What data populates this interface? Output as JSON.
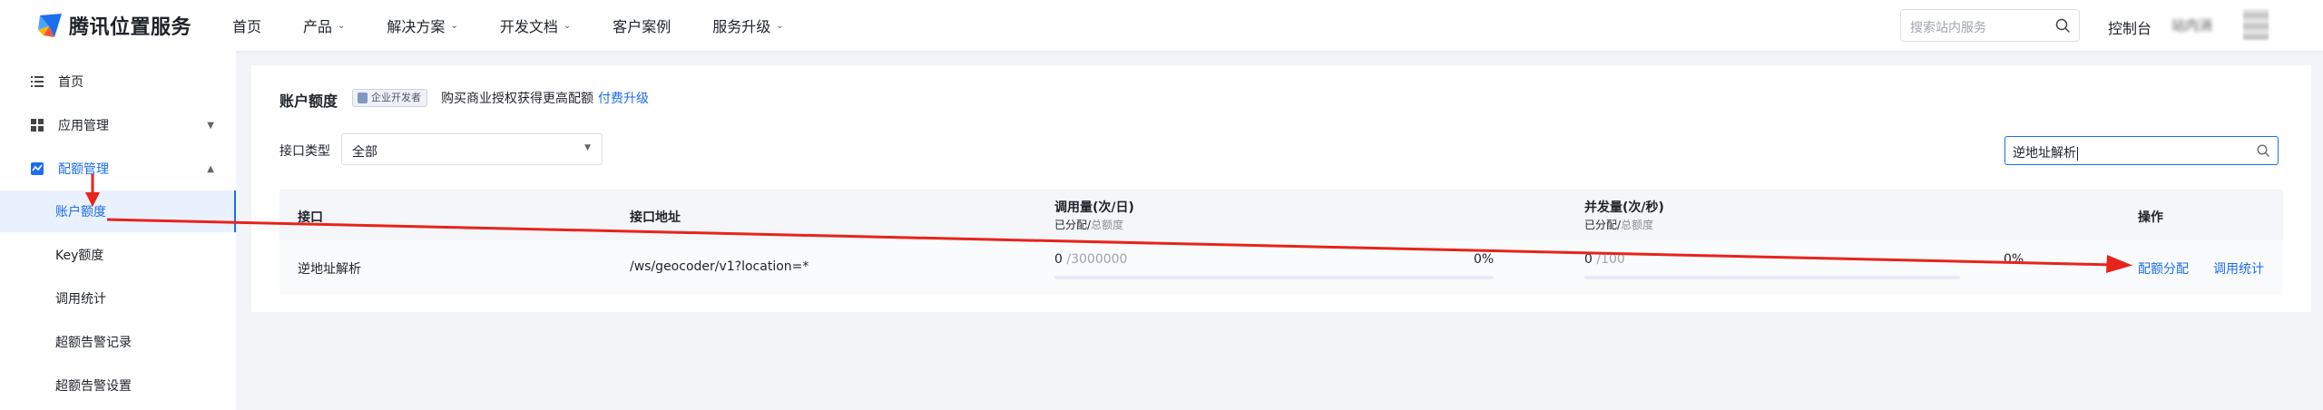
{
  "brand": {
    "name": "腾讯位置服务"
  },
  "nav": {
    "items": [
      {
        "label": "首页",
        "dropdown": false
      },
      {
        "label": "产品",
        "dropdown": true
      },
      {
        "label": "解决方案",
        "dropdown": true
      },
      {
        "label": "开发文档",
        "dropdown": true
      },
      {
        "label": "客户案例",
        "dropdown": false
      },
      {
        "label": "服务升级",
        "dropdown": true
      }
    ],
    "search_placeholder": "搜索站内服务",
    "console_label": "控制台",
    "user_name": "站内消"
  },
  "sidebar": {
    "items": [
      {
        "label": "首页",
        "icon": "list-icon"
      },
      {
        "label": "应用管理",
        "icon": "grid-icon",
        "expand": "down"
      },
      {
        "label": "配额管理",
        "icon": "quota-icon",
        "expand": "up",
        "active": true
      }
    ],
    "sub_items": [
      {
        "label": "账户额度",
        "active": true
      },
      {
        "label": "Key额度"
      },
      {
        "label": "调用统计"
      },
      {
        "label": "超额告警记录"
      },
      {
        "label": "超额告警设置"
      }
    ]
  },
  "main": {
    "title": "账户额度",
    "badge": "企业开发者",
    "upgrade_text": "购买商业授权获得更高配额",
    "upgrade_link": "付费升级",
    "filter_label": "接口类型",
    "filter_value": "全部",
    "search_value": "逆地址解析"
  },
  "table": {
    "headers": {
      "interface": "接口",
      "address": "接口地址",
      "calls": "调用量(次/日)",
      "concurrency": "并发量(次/秒)",
      "sub_allocated": "已分配",
      "sub_sep": "/",
      "sub_total": "总额度",
      "actions": "操作"
    },
    "rows": [
      {
        "interface": "逆地址解析",
        "address": "/ws/geocoder/v1?location=*",
        "calls_used": "0",
        "calls_total": "/3000000",
        "calls_pct": "0%",
        "calls_fraction": 0,
        "conc_used": "0",
        "conc_total": "/100",
        "conc_pct": "0%",
        "conc_fraction": 0,
        "actions": [
          "配额分配",
          "调用统计"
        ]
      }
    ]
  },
  "colors": {
    "accent": "#1c6ef0",
    "annotation": "#e8231c",
    "background": "#f3f4f7"
  }
}
